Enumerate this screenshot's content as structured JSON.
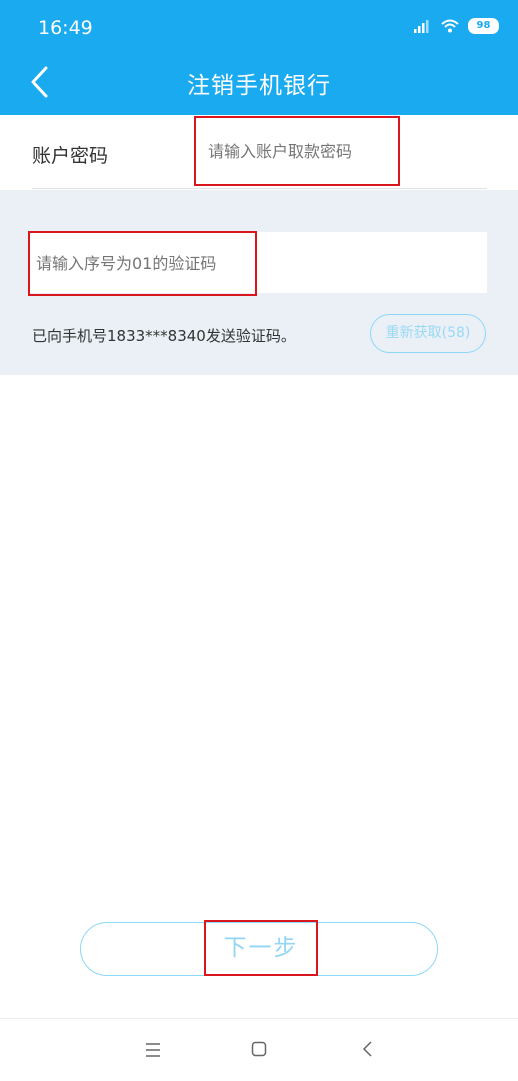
{
  "status_bar": {
    "time": "16:49",
    "battery": "98"
  },
  "header": {
    "title": "注销手机银行"
  },
  "password": {
    "label": "账户密码",
    "placeholder": "请输入账户取款密码",
    "value": ""
  },
  "verification": {
    "placeholder": "请输入序号为01的验证码",
    "value": "",
    "sent_message": "已向手机号1833***8340发送验证码。",
    "resend_label": "重新获取(58)"
  },
  "footer": {
    "next_label": "下一步"
  },
  "colors": {
    "brand": "#1aaaf0",
    "highlight_border": "#d9161e",
    "button_outline": "#8dd8f7"
  }
}
